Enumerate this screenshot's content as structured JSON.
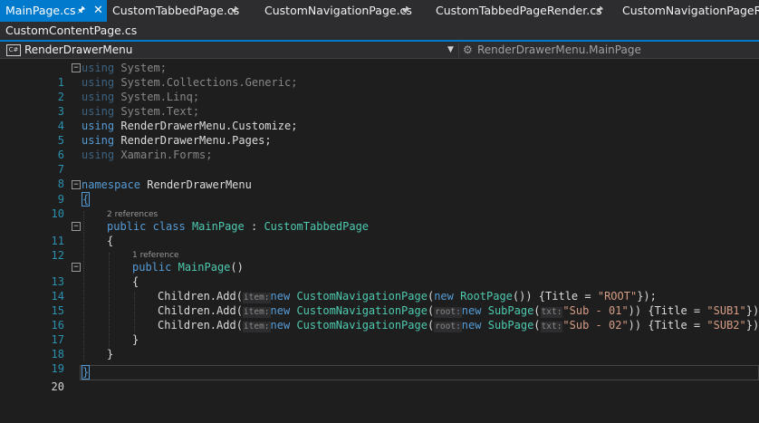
{
  "tabs": [
    {
      "label": "MainPage.cs",
      "active": true
    },
    {
      "label": "CustomTabbedPage.cs"
    },
    {
      "label": "CustomNavigationPage.cs"
    },
    {
      "label": "CustomTabbedPageRender.cs"
    },
    {
      "label": "CustomNavigationPageRender.cs"
    }
  ],
  "tabs_row2": [
    {
      "label": "CustomContentPage.cs"
    }
  ],
  "nav": {
    "project": "RenderDrawerMenu",
    "member": "RenderDrawerMenu.MainPage"
  },
  "icons": {
    "tab_pin": "pin-icon",
    "tab_close": "close-icon",
    "project_icon": "csharp-project-icon",
    "dropdown": "chevron-down-icon",
    "member_icon": "class-member-icon"
  },
  "colors": {
    "accent": "#007acc",
    "keyword": "#569cd6",
    "type": "#4ec9b0",
    "string": "#d69d85",
    "line_number": "#2b91af",
    "background": "#1e1e1e"
  },
  "editor": {
    "line_numbers": [
      "1",
      "2",
      "3",
      "4",
      "5",
      "6",
      "7",
      "8",
      "9",
      "10",
      "11",
      "12",
      "13",
      "14",
      "15",
      "16",
      "17",
      "18",
      "19",
      "20"
    ],
    "using_kw": "using",
    "usings": [
      "System",
      "System.Collections.Generic",
      "System.Linq",
      "System.Text",
      "RenderDrawerMenu.Customize",
      "RenderDrawerMenu.Pages",
      "Xamarin.Forms"
    ],
    "namespace_kw": "namespace",
    "namespace_name": "RenderDrawerMenu",
    "lens_class": "2 references",
    "lens_ctor": "1 reference",
    "public_kw": "public",
    "class_kw": "class",
    "class_name": "MainPage",
    "base_class": "CustomTabbedPage",
    "ctor_name": "MainPage",
    "children_add": "Children.Add(",
    "hint_item": "item:",
    "hint_root": "root:",
    "hint_txt": "txt:",
    "new_kw": "new",
    "nav_page": "CustomNavigationPage",
    "root_page": "RootPage",
    "sub_page": "SubPage",
    "title_prop": "Title",
    "root_title": "\"ROOT\"",
    "sub1_arg": "\"Sub - 01\"",
    "sub1_title": "\"SUB1\"",
    "sub2_arg": "\"Sub - 02\"",
    "sub2_title": "\"SUB2\""
  }
}
